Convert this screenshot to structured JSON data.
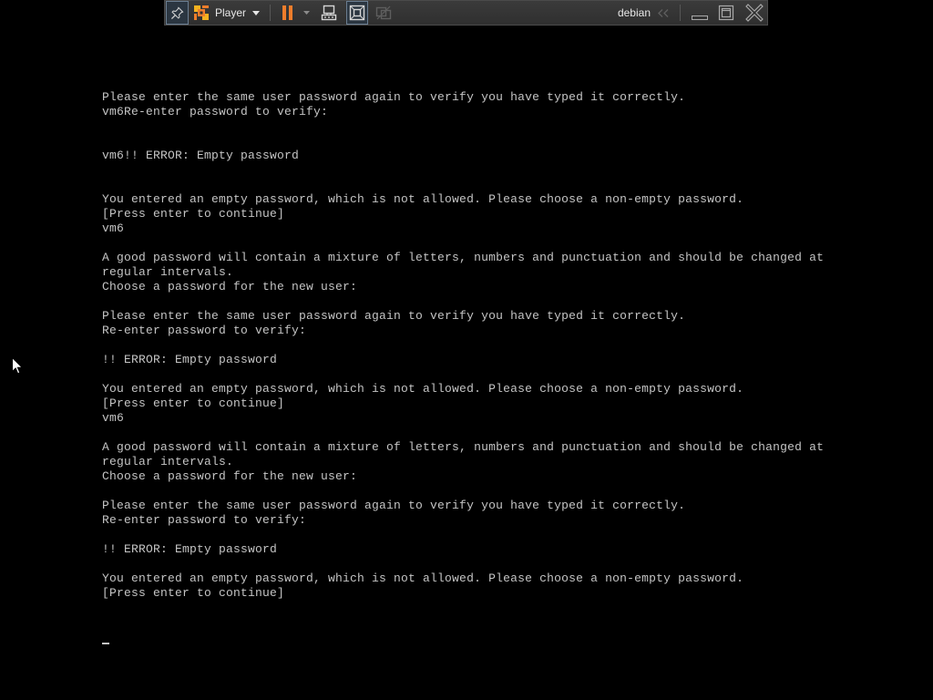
{
  "toolbar": {
    "player_menu": {
      "label": "Player",
      "logo_icon": "vmware-player-logo-icon",
      "caret_icon": "chevron-down-icon"
    },
    "buttons": {
      "pin": {
        "icon": "pin-icon",
        "pressed": true
      },
      "pause": {
        "icon": "pause-icon"
      },
      "power_menu": {
        "icon": "chevron-down-icon"
      },
      "send_ctrl_alt_del": {
        "icon": "send-ctrl-alt-del-icon"
      },
      "full_screen": {
        "icon": "full-screen-icon",
        "pressed": true
      },
      "unity": {
        "icon": "unity-icon",
        "enabled": false
      }
    },
    "vm_name": "debian",
    "collapse": {
      "icon": "double-chevron-left-icon"
    },
    "window_controls": {
      "minimize": {
        "icon": "minimize-icon"
      },
      "restore": {
        "icon": "restore-icon"
      },
      "close": {
        "icon": "close-icon"
      }
    }
  },
  "terminal": {
    "lines": [
      "Please enter the same user password again to verify you have typed it correctly.",
      "vm6Re-enter password to verify:",
      "vm6!! ERROR: Empty password",
      "You entered an empty password, which is not allowed. Please choose a non-empty password.",
      "[Press enter to continue]",
      "vm6",
      "A good password will contain a mixture of letters, numbers and punctuation and should be changed at",
      "regular intervals.",
      "Choose a password for the new user:",
      "Please enter the same user password again to verify you have typed it correctly.",
      "Re-enter password to verify:",
      "!! ERROR: Empty password",
      "You entered an empty password, which is not allowed. Please choose a non-empty password.",
      "[Press enter to continue]",
      "vm6",
      "A good password will contain a mixture of letters, numbers and punctuation and should be changed at",
      "regular intervals.",
      "Choose a password for the new user:",
      "Please enter the same user password again to verify you have typed it correctly.",
      "Re-enter password to verify:",
      "!! ERROR: Empty password",
      "You entered an empty password, which is not allowed. Please choose a non-empty password.",
      "[Press enter to continue]"
    ],
    "cursor_visible": true
  },
  "mouse_pointer": {
    "icon": "mouse-pointer-icon"
  },
  "colors": {
    "console_background": "#000000",
    "console_text": "#c4c4c4",
    "toolbar_background": "#2f2f2f",
    "accent_orange": "#ef7d2b",
    "logo_yellow": "#f6b21f",
    "icon_light": "#d6d6d6",
    "icon_mid": "#a8a8a8",
    "icon_disabled": "#5e5e5e",
    "highlight_border": "#6b7e92"
  }
}
